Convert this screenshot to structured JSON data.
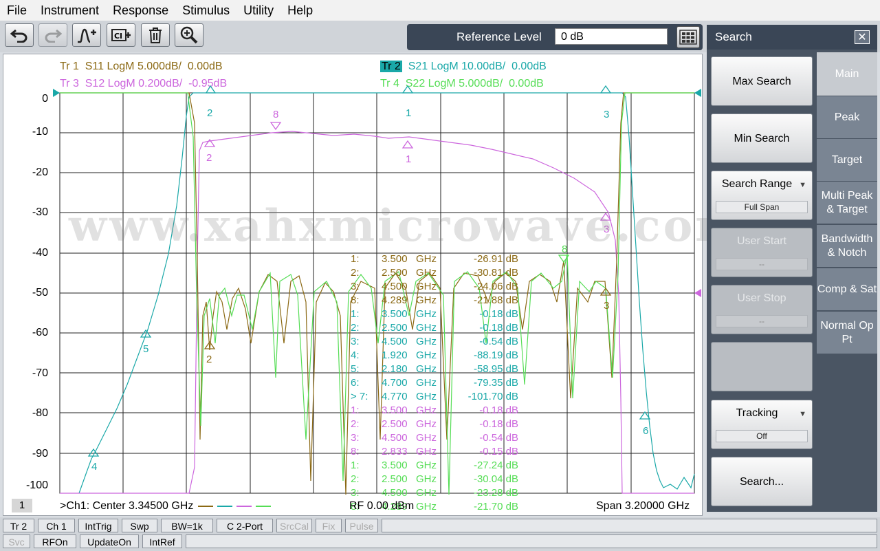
{
  "menu": [
    "File",
    "Instrument",
    "Response",
    "Stimulus",
    "Utility",
    "Help"
  ],
  "toolbar": {
    "icons": [
      "undo-icon",
      "redo-icon",
      "add-marker-icon",
      "clear-icon",
      "delete-icon",
      "zoom-icon"
    ],
    "reference_level_label": "Reference Level",
    "reference_level_value": "0 dB"
  },
  "traces": [
    {
      "label": "Tr 1",
      "text": "S11 LogM 5.000dB/  0.00dB",
      "color": "#8B6914"
    },
    {
      "label": "Tr 2",
      "text": "S21 LogM 10.00dB/  0.00dB",
      "color": "#1aa8a8"
    },
    {
      "label": "Tr 3",
      "text": "S12 LogM 0.200dB/  -0.95dB",
      "color": "#cc66dd"
    },
    {
      "label": "Tr 4",
      "text": "S22 LogM 5.000dB/  0.00dB",
      "color": "#55dd55"
    }
  ],
  "y_axis_labels": [
    "0",
    "-10",
    "-20",
    "-30",
    "-40",
    "-50",
    "-60",
    "-70",
    "-80",
    "-90",
    "-100"
  ],
  "watermark": "www.xahxmicrowave.com",
  "marker_table": [
    {
      "n": "1:",
      "f": "3.500",
      "u": "GHz",
      "v": "-26.91 dB",
      "c": "#8B6914"
    },
    {
      "n": "2:",
      "f": "2.500",
      "u": "GHz",
      "v": "-30.81 dB",
      "c": "#8B6914"
    },
    {
      "n": "3:",
      "f": "4.500",
      "u": "GHz",
      "v": "-24.06 dB",
      "c": "#8B6914"
    },
    {
      "n": "8:",
      "f": "4.289",
      "u": "GHz",
      "v": "-21.88 dB",
      "c": "#8B6914"
    },
    {
      "n": "1:",
      "f": "3.500",
      "u": "GHz",
      "v": "-0.18 dB",
      "c": "#1aa8a8"
    },
    {
      "n": "2:",
      "f": "2.500",
      "u": "GHz",
      "v": "-0.18 dB",
      "c": "#1aa8a8"
    },
    {
      "n": "3:",
      "f": "4.500",
      "u": "GHz",
      "v": "-0.54 dB",
      "c": "#1aa8a8"
    },
    {
      "n": "4:",
      "f": "1.920",
      "u": "GHz",
      "v": "-88.19 dB",
      "c": "#1aa8a8"
    },
    {
      "n": "5:",
      "f": "2.180",
      "u": "GHz",
      "v": "-58.95 dB",
      "c": "#1aa8a8"
    },
    {
      "n": "6:",
      "f": "4.700",
      "u": "GHz",
      "v": "-79.35 dB",
      "c": "#1aa8a8"
    },
    {
      "n": "> 7:",
      "f": "4.770",
      "u": "GHz",
      "v": "-101.70 dB",
      "c": "#1aa8a8"
    },
    {
      "n": "1:",
      "f": "3.500",
      "u": "GHz",
      "v": "-0.18 dB",
      "c": "#cc66dd"
    },
    {
      "n": "2:",
      "f": "2.500",
      "u": "GHz",
      "v": "-0.18 dB",
      "c": "#cc66dd"
    },
    {
      "n": "3:",
      "f": "4.500",
      "u": "GHz",
      "v": "-0.54 dB",
      "c": "#cc66dd"
    },
    {
      "n": "8:",
      "f": "2.833",
      "u": "GHz",
      "v": "-0.15 dB",
      "c": "#cc66dd"
    },
    {
      "n": "1:",
      "f": "3.500",
      "u": "GHz",
      "v": "-27.24 dB",
      "c": "#55dd55"
    },
    {
      "n": "2:",
      "f": "2.500",
      "u": "GHz",
      "v": "-30.04 dB",
      "c": "#55dd55"
    },
    {
      "n": "3:",
      "f": "4.500",
      "u": "GHz",
      "v": "-23.28 dB",
      "c": "#55dd55"
    },
    {
      "n": "8:",
      "f": "4.289",
      "u": "GHz",
      "v": "-21.70 dB",
      "c": "#55dd55"
    }
  ],
  "footer": {
    "channel_box": "1",
    "center": ">Ch1:  Center  3.34500 GHz",
    "rf": "RF    0.00 dBm",
    "span": "Span  3.20000 GHz"
  },
  "search_panel": {
    "title": "Search",
    "close": "✕",
    "buttons": [
      {
        "label": "Max Search"
      },
      {
        "label": "Min Search"
      },
      {
        "label": "Search Range",
        "sub": "Full Span"
      },
      {
        "label": "User Start",
        "sub": "--"
      },
      {
        "label": "User Stop",
        "sub": "--"
      },
      {
        "label": "Tracking",
        "sub": "Off"
      },
      {
        "label": "Search..."
      }
    ],
    "tabs": [
      "Main",
      "Peak",
      "Target",
      "Multi Peak & Target",
      "Bandwidth & Notch",
      "Comp & Sat",
      "Normal Op Pt"
    ]
  },
  "status_row1": [
    "Tr 2",
    "Ch 1",
    "IntTrig",
    "Swp",
    "BW=1k",
    "C  2-Port",
    "SrcCal",
    "Fix",
    "Pulse"
  ],
  "status_row2": [
    "Svc",
    "RFOn",
    "UpdateOn",
    "IntRef"
  ]
}
